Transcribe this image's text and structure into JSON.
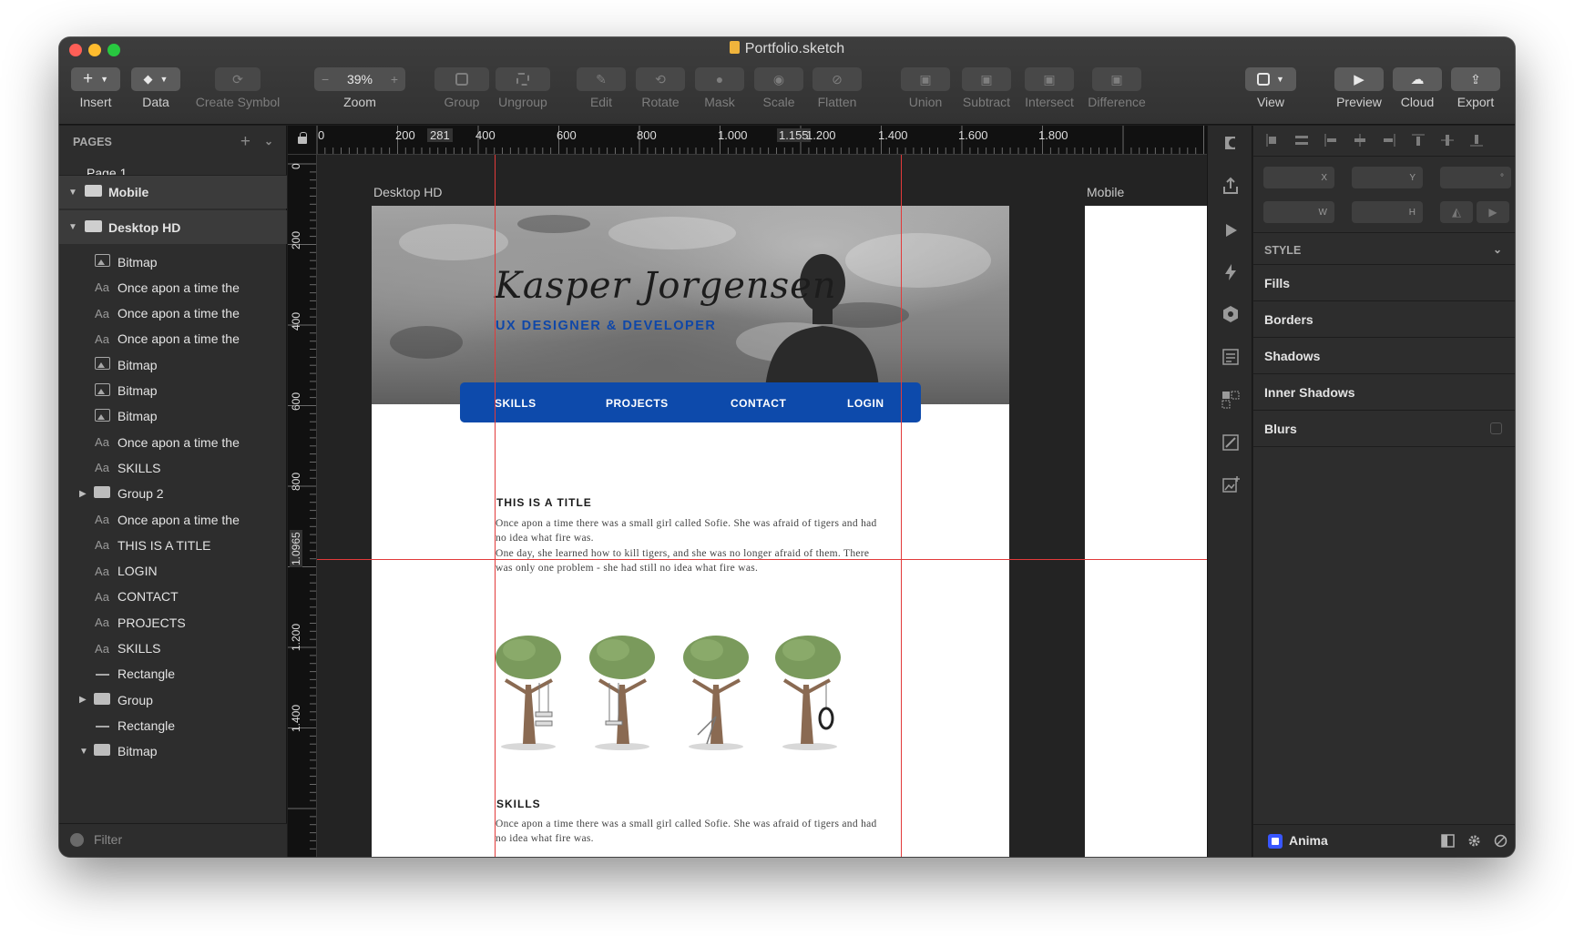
{
  "window": {
    "title": "Portfolio.sketch"
  },
  "toolbar": {
    "insert": "Insert",
    "data": "Data",
    "create_symbol": "Create Symbol",
    "zoom_value": "39%",
    "zoom": "Zoom",
    "group": "Group",
    "ungroup": "Ungroup",
    "edit": "Edit",
    "rotate": "Rotate",
    "mask": "Mask",
    "scale": "Scale",
    "flatten": "Flatten",
    "union": "Union",
    "subtract": "Subtract",
    "intersect": "Intersect",
    "difference": "Difference",
    "view": "View",
    "preview": "Preview",
    "cloud": "Cloud",
    "export": "Export"
  },
  "pages_panel": {
    "header": "PAGES",
    "current_page": "Page 1",
    "filter_placeholder": "Filter",
    "artboards": [
      "Mobile",
      "Desktop HD"
    ],
    "layers": [
      {
        "type": "image",
        "name": "Bitmap"
      },
      {
        "type": "text",
        "name": "Once apon a time the"
      },
      {
        "type": "text",
        "name": "Once apon a time the"
      },
      {
        "type": "text",
        "name": "Once apon a time the"
      },
      {
        "type": "image",
        "name": "Bitmap"
      },
      {
        "type": "image",
        "name": "Bitmap"
      },
      {
        "type": "image",
        "name": "Bitmap"
      },
      {
        "type": "text",
        "name": "Once apon a time the"
      },
      {
        "type": "text",
        "name": "SKILLS"
      },
      {
        "type": "group",
        "name": "Group 2"
      },
      {
        "type": "text",
        "name": "Once apon a time the"
      },
      {
        "type": "text",
        "name": "THIS IS A TITLE"
      },
      {
        "type": "text",
        "name": "LOGIN"
      },
      {
        "type": "text",
        "name": "CONTACT"
      },
      {
        "type": "text",
        "name": "PROJECTS"
      },
      {
        "type": "text",
        "name": "SKILLS"
      },
      {
        "type": "shape",
        "name": "Rectangle"
      },
      {
        "type": "group",
        "name": "Group"
      },
      {
        "type": "shape",
        "name": "Rectangle"
      },
      {
        "type": "group-open",
        "name": "Bitmap"
      }
    ]
  },
  "rulers": {
    "top": [
      "0",
      "200",
      "281",
      "400",
      "600",
      "800",
      "1.000",
      "1.155",
      "1.200",
      "1.400",
      "1.600",
      "1.800"
    ],
    "left": [
      "0",
      "200",
      "400",
      "600",
      "800",
      "1.0965",
      "1.200",
      "1.400"
    ]
  },
  "canvas": {
    "desktop_label": "Desktop HD",
    "mobile_label": "Mobile",
    "signature": "Kasper Jorgensen",
    "subtitle": "UX DESIGNER & DEVELOPER",
    "nav": [
      "SKILLS",
      "PROJECTS",
      "CONTACT",
      "LOGIN"
    ],
    "section_title": "THIS IS A TITLE",
    "para1": "Once apon a time there was a small girl called Sofie. She was afraid of tigers and had no idea what fire was.",
    "para2": "One day, she learned how to kill tigers, and she was no longer afraid of them. There was only one problem - she had still no idea what fire was.",
    "skills_title": "SKILLS",
    "para3": "Once apon a time there was a small girl called Sofie. She was afraid of tigers and had no idea what fire was."
  },
  "inspector": {
    "x_label": "X",
    "y_label": "Y",
    "rot_label": "°",
    "w_label": "W",
    "h_label": "H",
    "style_header": "STYLE",
    "sections": [
      "Fills",
      "Borders",
      "Shadows",
      "Inner Shadows",
      "Blurs"
    ],
    "plugin": "Anima"
  },
  "colors": {
    "guide": "#e23a3a",
    "nav_blue": "#0d4aab",
    "subtitle_blue": "#0f47a8"
  }
}
